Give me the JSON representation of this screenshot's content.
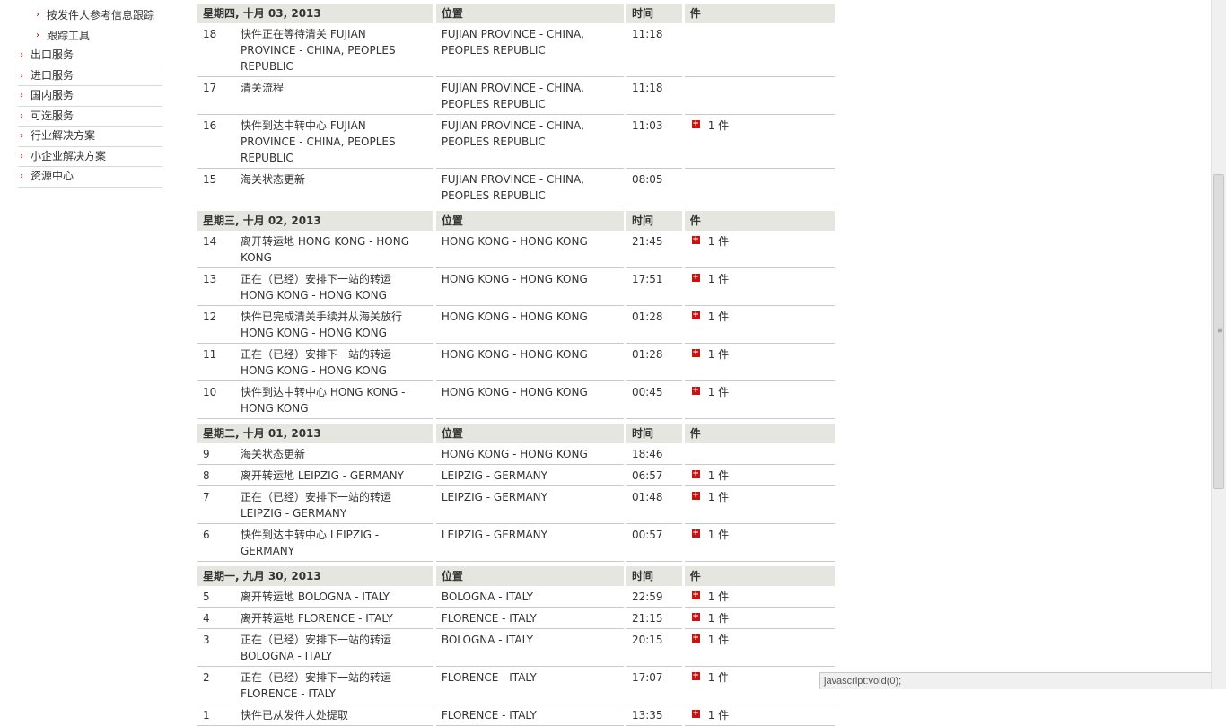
{
  "sidebar": {
    "sub_items": [
      {
        "label": "按发件人参考信息跟踪"
      },
      {
        "label": "跟踪工具"
      }
    ],
    "nav_items": [
      {
        "label": "出口服务"
      },
      {
        "label": "进口服务"
      },
      {
        "label": "国内服务"
      },
      {
        "label": "可选服务"
      },
      {
        "label": "行业解决方案"
      },
      {
        "label": "小企业解决方案"
      },
      {
        "label": "资源中心"
      }
    ],
    "arrow_glyph": "›"
  },
  "columns": {
    "location": "位置",
    "time": "时间",
    "pieces": "件"
  },
  "groups": [
    {
      "date": "星期四, 十月 03, 2013",
      "rows": [
        {
          "num": "18",
          "activity": "快件正在等待清关 FUJIAN PROVINCE - CHINA, PEOPLES REPUBLIC",
          "location": "FUJIAN PROVINCE - CHINA, PEOPLES REPUBLIC",
          "time": "11:18",
          "pieces": ""
        },
        {
          "num": "17",
          "activity": "清关流程",
          "location": "FUJIAN PROVINCE - CHINA, PEOPLES REPUBLIC",
          "time": "11:18",
          "pieces": ""
        },
        {
          "num": "16",
          "activity": "快件到达中转中心 FUJIAN PROVINCE - CHINA, PEOPLES REPUBLIC",
          "location": "FUJIAN PROVINCE - CHINA, PEOPLES REPUBLIC",
          "time": "11:03",
          "pieces": "1 件"
        },
        {
          "num": "15",
          "activity": "海关状态更新",
          "location": "FUJIAN PROVINCE - CHINA, PEOPLES REPUBLIC",
          "time": "08:05",
          "pieces": ""
        }
      ]
    },
    {
      "date": "星期三, 十月 02, 2013",
      "rows": [
        {
          "num": "14",
          "activity": "离开转运地 HONG KONG - HONG KONG",
          "location": "HONG KONG - HONG KONG",
          "time": "21:45",
          "pieces": "1 件"
        },
        {
          "num": "13",
          "activity": "正在（已经）安排下一站的转运 HONG KONG - HONG KONG",
          "location": "HONG KONG - HONG KONG",
          "time": "17:51",
          "pieces": "1 件"
        },
        {
          "num": "12",
          "activity": "快件已完成清关手续并从海关放行 HONG KONG - HONG KONG",
          "location": "HONG KONG - HONG KONG",
          "time": "01:28",
          "pieces": "1 件"
        },
        {
          "num": "11",
          "activity": "正在（已经）安排下一站的转运 HONG KONG - HONG KONG",
          "location": "HONG KONG - HONG KONG",
          "time": "01:28",
          "pieces": "1 件"
        },
        {
          "num": "10",
          "activity": "快件到达中转中心 HONG KONG - HONG KONG",
          "location": "HONG KONG - HONG KONG",
          "time": "00:45",
          "pieces": "1 件"
        }
      ]
    },
    {
      "date": "星期二, 十月 01, 2013",
      "rows": [
        {
          "num": "9",
          "activity": "海关状态更新",
          "location": "HONG KONG - HONG KONG",
          "time": "18:46",
          "pieces": ""
        },
        {
          "num": "8",
          "activity": "离开转运地 LEIPZIG - GERMANY",
          "location": "LEIPZIG - GERMANY",
          "time": "06:57",
          "pieces": "1 件"
        },
        {
          "num": "7",
          "activity": "正在（已经）安排下一站的转运 LEIPZIG - GERMANY",
          "location": "LEIPZIG - GERMANY",
          "time": "01:48",
          "pieces": "1 件"
        },
        {
          "num": "6",
          "activity": "快件到达中转中心 LEIPZIG - GERMANY",
          "location": "LEIPZIG - GERMANY",
          "time": "00:57",
          "pieces": "1 件"
        }
      ]
    },
    {
      "date": "星期一, 九月 30, 2013",
      "rows": [
        {
          "num": "5",
          "activity": "离开转运地 BOLOGNA - ITALY",
          "location": "BOLOGNA - ITALY",
          "time": "22:59",
          "pieces": "1 件"
        },
        {
          "num": "4",
          "activity": "离开转运地 FLORENCE - ITALY",
          "location": "FLORENCE - ITALY",
          "time": "21:15",
          "pieces": "1 件"
        },
        {
          "num": "3",
          "activity": "正在（已经）安排下一站的转运 BOLOGNA - ITALY",
          "location": "BOLOGNA - ITALY",
          "time": "20:15",
          "pieces": "1 件"
        },
        {
          "num": "2",
          "activity": "正在（已经）安排下一站的转运 FLORENCE - ITALY",
          "location": "FLORENCE - ITALY",
          "time": "17:07",
          "pieces": "1 件"
        },
        {
          "num": "1",
          "activity": "快件已从发件人处提取",
          "location": "FLORENCE - ITALY",
          "time": "13:35",
          "pieces": "1 件"
        }
      ]
    }
  ],
  "status_bar": {
    "text": "javascript:void(0);"
  },
  "colors": {
    "accent": "#cc1111",
    "header_bg": "#e6e6e1"
  }
}
